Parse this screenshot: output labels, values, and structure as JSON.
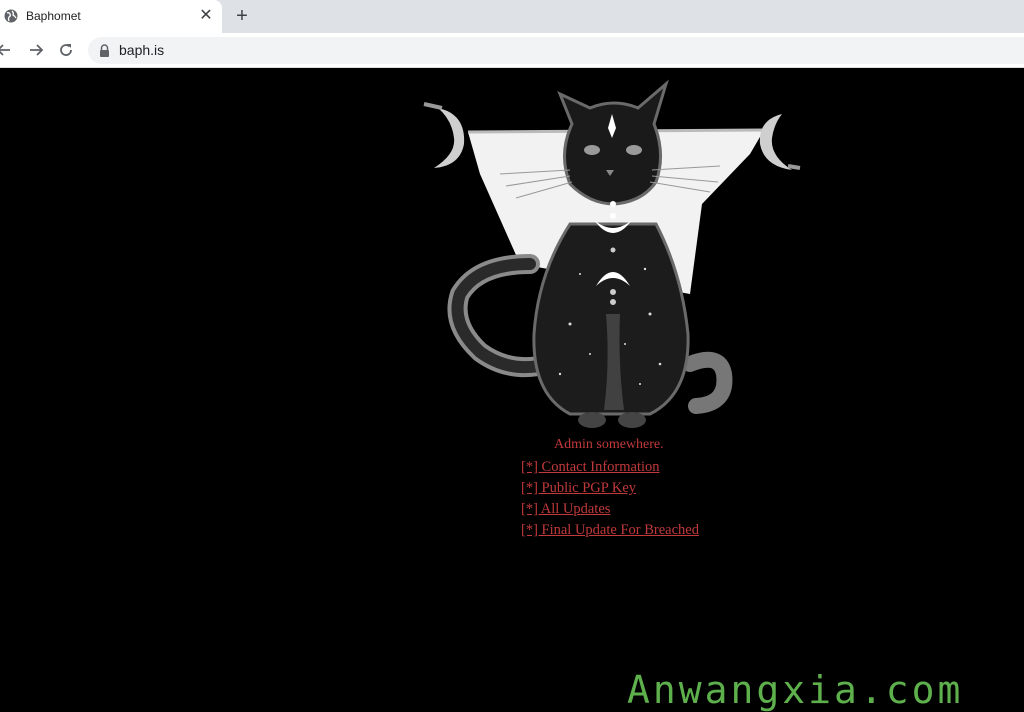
{
  "browser": {
    "tab_title": "Baphomet",
    "close_glyph": "✕",
    "new_tab_glyph": "+",
    "url": "baph.is"
  },
  "page": {
    "caption": "Admin somewhere.",
    "links": [
      "[*] Contact Information",
      "[*] Public PGP Key",
      "[*] All Updates",
      "[*] Final Update For Breached"
    ],
    "link_color": "#c0393b"
  },
  "watermark": "Anwangxia.com"
}
